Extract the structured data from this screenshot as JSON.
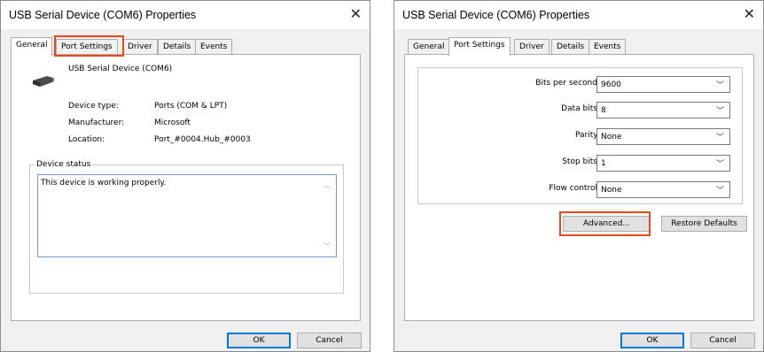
{
  "left_dialog": {
    "title": "USB Serial Device (COM6) Properties",
    "close_glyph": "✕",
    "tabs": [
      "General",
      "Port Settings",
      "Driver",
      "Details",
      "Events"
    ],
    "active_tab": "General",
    "device_name": "USB Serial Device (COM6)",
    "device_icon": "usb-plug-icon",
    "props": [
      {
        "label": "Device type:",
        "value": "Ports (COM & LPT)"
      },
      {
        "label": "Manufacturer:",
        "value": "Microsoft"
      },
      {
        "label": "Location:",
        "value": "Port_#0004.Hub_#0003"
      }
    ],
    "status_group_title": "Device status",
    "status_text": "This device is working properly.",
    "ok_label": "OK",
    "cancel_label": "Cancel"
  },
  "right_dialog": {
    "title": "USB Serial Device (COM6) Properties",
    "close_glyph": "✕",
    "tabs": [
      "General",
      "Port Settings",
      "Driver",
      "Details",
      "Events"
    ],
    "active_tab": "Port Settings",
    "settings": [
      {
        "label": "Bits per second:",
        "value": "9600"
      },
      {
        "label": "Data bits:",
        "value": "8"
      },
      {
        "label": "Parity:",
        "value": "None"
      },
      {
        "label": "Stop bits:",
        "value": "1"
      },
      {
        "label": "Flow control:",
        "value": "None"
      }
    ],
    "advanced_label": "Advanced...",
    "restore_label": "Restore Defaults",
    "ok_label": "OK",
    "cancel_label": "Cancel"
  },
  "highlight_color": "#e8481c",
  "accent_color": "#0078d7"
}
